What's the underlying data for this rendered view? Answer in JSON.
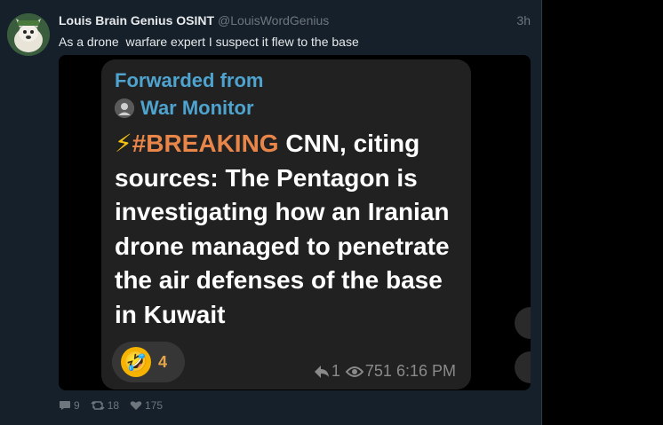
{
  "tweet": {
    "author_name": "Louis Brain Genius OSINT",
    "author_handle": "@LouisWordGenius",
    "timestamp": "3h",
    "text": "As a drone  warfare expert I suspect it flew to the base",
    "replies": "9",
    "retweets": "18",
    "likes": "175"
  },
  "telegram": {
    "forwarded_label": "Forwarded from",
    "source": "War Monitor",
    "bolt": "⚡",
    "hashtag": "#BREAKING",
    "message_rest": " CNN, citing sources: The Pentagon is investigating how an Iranian drone managed to penetrate the air defenses of the base in Kuwait",
    "reaction_emoji": "🤣",
    "reaction_count": "4",
    "forwards": "1",
    "views": "751",
    "time": "6:16 PM"
  },
  "icons": {
    "reply": "reply-icon",
    "retweet": "retweet-icon",
    "like": "heart-icon",
    "views": "eye-icon",
    "forward": "share-arrow-icon"
  }
}
